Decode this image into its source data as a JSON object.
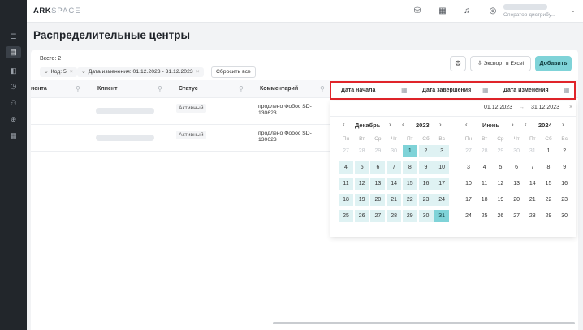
{
  "app": {
    "logo_main": "ARK",
    "logo_accent": "SPACE"
  },
  "sidebar": {
    "icons": [
      "list-icon",
      "database-icon",
      "panel-icon",
      "clock-icon",
      "users-icon",
      "plus-circle-icon",
      "calendar-icon"
    ]
  },
  "topbar": {
    "icons": [
      "coins-icon",
      "apps-grid-icon",
      "bell-icon",
      "compass-icon"
    ],
    "user_role": "Оператор дистрибу..."
  },
  "page": {
    "title": "Распределительные центры"
  },
  "toolbar": {
    "total": "Всего: 2",
    "filters": [
      {
        "label": "Код: 5"
      },
      {
        "label": "Дата изменения: 01.12.2023 - 31.12.2023"
      }
    ],
    "reset_label": "Сбросить все",
    "export_label": "Экспорт в Excel",
    "add_label": "Добавить"
  },
  "table": {
    "columns": [
      "иента",
      "Клиент",
      "Статус",
      "Комментарий"
    ],
    "rows": [
      {
        "status": "Активный",
        "comment": "продлено Фобос SD-130623"
      },
      {
        "status": "Активный",
        "comment": "продлено Фобос SD-130623"
      }
    ]
  },
  "date_columns": [
    "Дата начала",
    "Дата завершения",
    "Дата изменения"
  ],
  "datepicker": {
    "start_value": "01.12.2023",
    "arrow": "→",
    "end_value": "31.12.2023",
    "clear": "×",
    "weekdays": [
      "Пн",
      "Вт",
      "Ср",
      "Чт",
      "Пт",
      "Сб",
      "Вс"
    ],
    "left": {
      "month": "Декабрь",
      "year": "2023",
      "days": [
        "27",
        "28",
        "29",
        "30",
        "1",
        "2",
        "3",
        "4",
        "5",
        "6",
        "7",
        "8",
        "9",
        "10",
        "11",
        "12",
        "13",
        "14",
        "15",
        "16",
        "17",
        "18",
        "19",
        "20",
        "21",
        "22",
        "23",
        "24",
        "25",
        "26",
        "27",
        "28",
        "29",
        "30",
        "31"
      ],
      "first_in_month_index": 4
    },
    "right": {
      "month": "Июнь",
      "year": "2024",
      "days": [
        "27",
        "28",
        "29",
        "30",
        "31",
        "1",
        "2",
        "3",
        "4",
        "5",
        "6",
        "7",
        "8",
        "9",
        "10",
        "11",
        "12",
        "13",
        "14",
        "15",
        "16",
        "17",
        "18",
        "19",
        "20",
        "21",
        "22",
        "23",
        "24",
        "25",
        "26",
        "27",
        "28",
        "29",
        "30"
      ],
      "first_in_month_index": 5
    },
    "colors": {
      "accent": "#7fd3d8",
      "range": "#dff2f3"
    }
  },
  "highlight_color": "#e0242a"
}
